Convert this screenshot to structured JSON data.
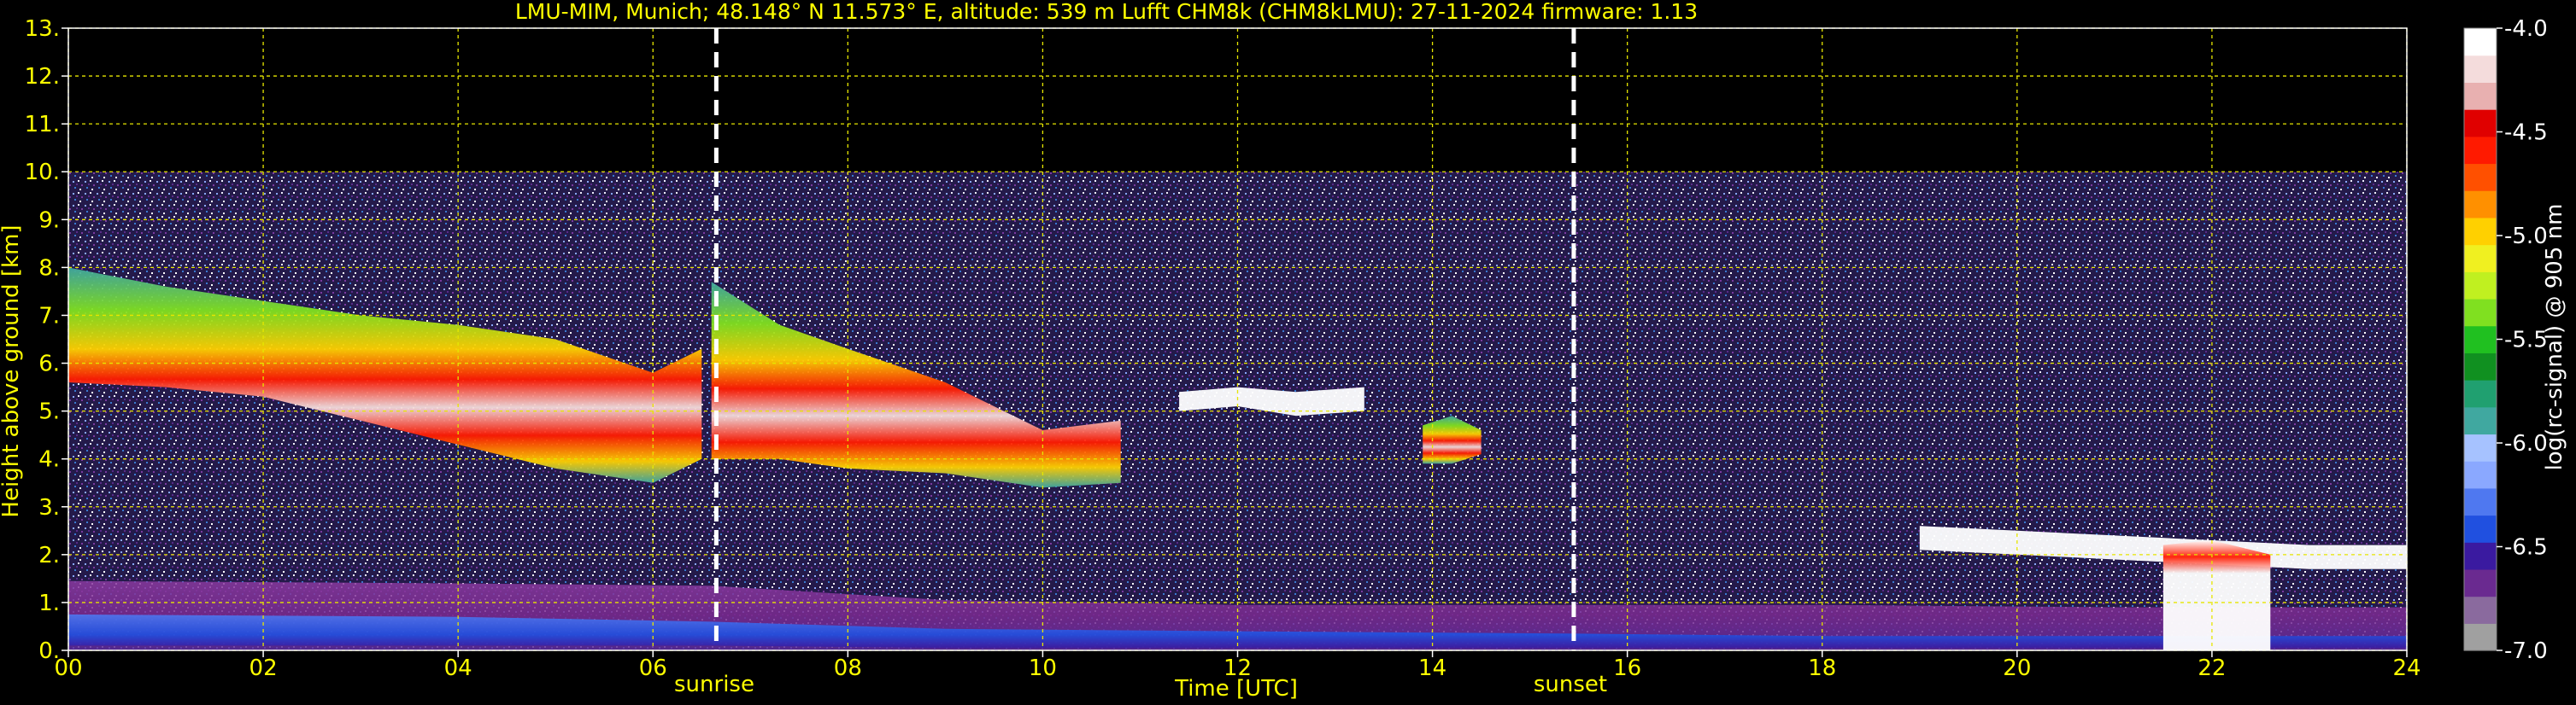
{
  "chart_data": {
    "type": "heatmap",
    "title": "LMU-MIM, Munich; 48.148° N 11.573° E, altitude: 539 m    Lufft CHM8k (CHM8kLMU): 27-11-2024    firmware: 1.13",
    "xlabel": "Time [UTC]",
    "ylabel": "Height above ground [km]",
    "xlim": [
      0,
      24
    ],
    "ylim": [
      0,
      13
    ],
    "x_ticks": [
      "00",
      "02",
      "04",
      "06",
      "08",
      "10",
      "12",
      "14",
      "16",
      "18",
      "20",
      "22",
      "24"
    ],
    "y_ticks": [
      "0.",
      "1.",
      "2.",
      "3.",
      "4.",
      "5.",
      "6.",
      "7.",
      "8.",
      "9.",
      "10.",
      "11.",
      "12.",
      "13."
    ],
    "grid": true,
    "grid_color": "#e6e600",
    "text_color": "#ffff00",
    "sunrise": {
      "x": 6.65,
      "label": "sunrise"
    },
    "sunset": {
      "x": 15.45,
      "label": "sunset"
    },
    "data_top_km": 10.0,
    "colorbar": {
      "label": "log(rc-signal) @ 905 nm",
      "min": -7.0,
      "max": -4.0,
      "ticks": [
        "-4.0",
        "-4.5",
        "-5.0",
        "-5.5",
        "-6.0",
        "-6.5",
        "-7.0"
      ],
      "colors": [
        "#a0a0a0",
        "#8a6a9e",
        "#6a2a90",
        "#3a1aa0",
        "#2050e0",
        "#4f78f0",
        "#8aa8ff",
        "#a6c2ff",
        "#40a8a0",
        "#20a070",
        "#109020",
        "#20c020",
        "#80e020",
        "#c0f020",
        "#f0f020",
        "#ffd000",
        "#ff9000",
        "#ff5000",
        "#ff1a00",
        "#e00000",
        "#e8b0b0",
        "#f4dcdc",
        "#ffffff"
      ]
    },
    "layers": [
      {
        "name": "boundary-layer",
        "t": [
          0,
          4,
          6.6,
          9,
          12,
          15.5,
          18,
          21,
          24
        ],
        "bottom": [
          0,
          0,
          0,
          0,
          0,
          0,
          0,
          0,
          0
        ],
        "top": [
          1.45,
          1.4,
          1.35,
          1.05,
          0.95,
          0.95,
          0.95,
          0.9,
          0.9
        ]
      },
      {
        "name": "aerosol-core",
        "t": [
          0,
          4,
          6.6,
          9,
          12,
          15.5,
          18,
          21,
          24
        ],
        "bottom": [
          0.1,
          0.1,
          0.1,
          0.05,
          0.05,
          0.05,
          0.05,
          0.05,
          0.05
        ],
        "top": [
          0.75,
          0.7,
          0.6,
          0.45,
          0.4,
          0.35,
          0.3,
          0.3,
          0.3
        ]
      }
    ],
    "clouds": [
      {
        "name": "cloud-band-morning",
        "t": [
          0,
          1,
          2,
          3,
          4,
          5,
          6,
          6.5
        ],
        "bottom": [
          5.6,
          5.5,
          5.3,
          4.8,
          4.3,
          3.8,
          3.5,
          4.0
        ],
        "top": [
          8.0,
          7.6,
          7.3,
          7.0,
          6.8,
          6.5,
          5.8,
          6.3
        ]
      },
      {
        "name": "cloud-band-late-morning",
        "t": [
          6.6,
          7.3,
          8.0,
          9.0,
          10.0,
          10.8
        ],
        "bottom": [
          4.0,
          4.0,
          3.8,
          3.7,
          3.4,
          3.5
        ],
        "top": [
          7.7,
          6.8,
          6.3,
          5.6,
          4.6,
          4.8
        ]
      },
      {
        "name": "cloud-noon",
        "t": [
          11.4,
          12.0,
          12.6,
          13.3
        ],
        "bottom": [
          5.0,
          5.1,
          4.9,
          5.0
        ],
        "top": [
          5.4,
          5.5,
          5.4,
          5.5
        ]
      },
      {
        "name": "cloud-14h",
        "t": [
          13.9,
          14.2,
          14.5
        ],
        "bottom": [
          3.9,
          3.9,
          4.1
        ],
        "top": [
          4.7,
          4.9,
          4.6
        ]
      },
      {
        "name": "cloud-evening",
        "t": [
          19.0,
          20.0,
          21.0,
          22.0,
          23.0,
          24.0
        ],
        "bottom": [
          2.1,
          2.0,
          1.9,
          1.8,
          1.7,
          1.7
        ],
        "top": [
          2.6,
          2.5,
          2.4,
          2.3,
          2.2,
          2.2
        ]
      },
      {
        "name": "fog-22h",
        "t": [
          21.5,
          22.0,
          22.6
        ],
        "bottom": [
          0.0,
          0.0,
          0.0
        ],
        "top": [
          2.2,
          2.3,
          2.0
        ]
      }
    ]
  }
}
